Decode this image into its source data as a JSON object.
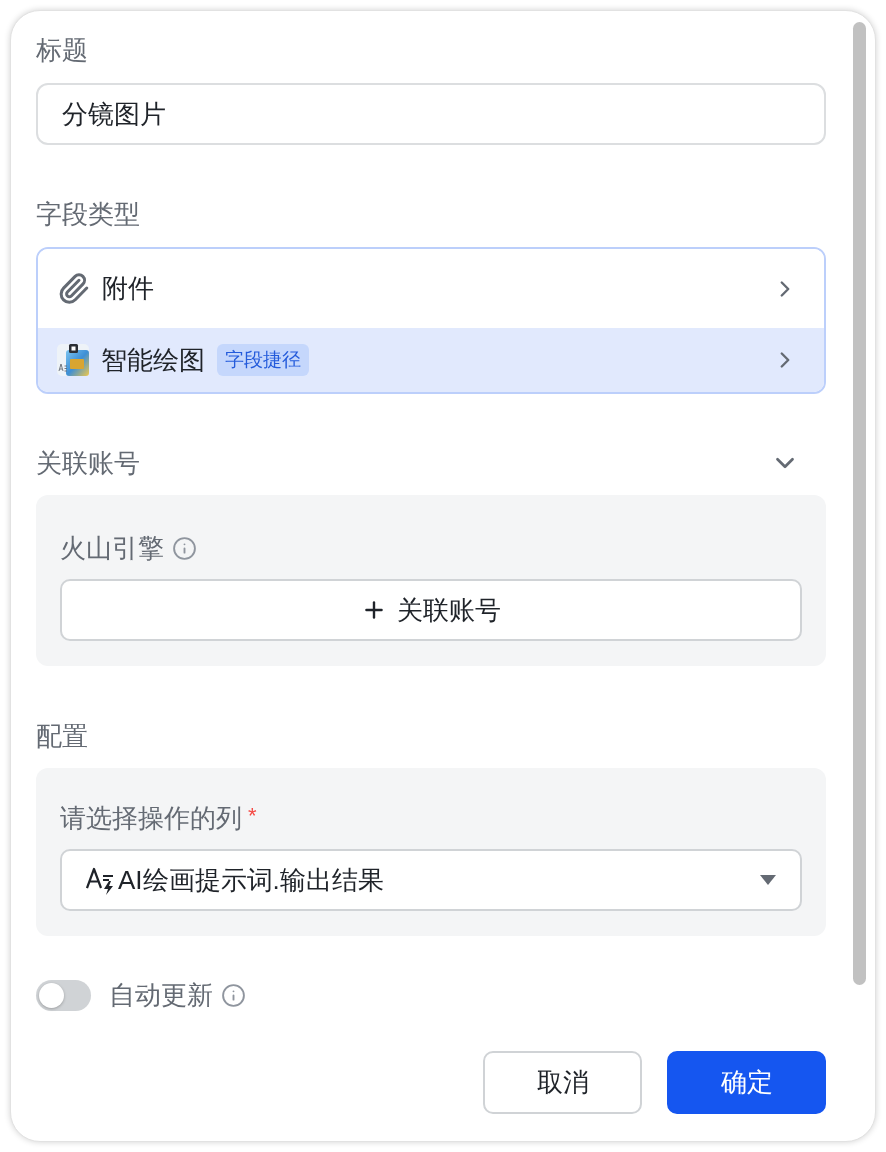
{
  "title_field": {
    "label": "标题",
    "value": "分镜图片"
  },
  "field_type": {
    "label": "字段类型",
    "options": [
      {
        "kind": "attachment",
        "label": "附件",
        "selected": false
      },
      {
        "kind": "smart-drawing",
        "label": "智能绘图",
        "tag": "字段捷径",
        "selected": true
      }
    ]
  },
  "linked_account": {
    "label": "关联账号",
    "expanded": true,
    "provider": "火山引擎",
    "button": "关联账号"
  },
  "config": {
    "label": "配置",
    "column_select": {
      "label": "请选择操作的列",
      "required_mark": "*",
      "value": "AI绘画提示词.输出结果"
    }
  },
  "auto_update": {
    "label": "自动更新",
    "on": false
  },
  "buttons": [
    {
      "kind": "secondary",
      "label": "取消"
    },
    {
      "kind": "primary",
      "label": "确定"
    }
  ]
}
